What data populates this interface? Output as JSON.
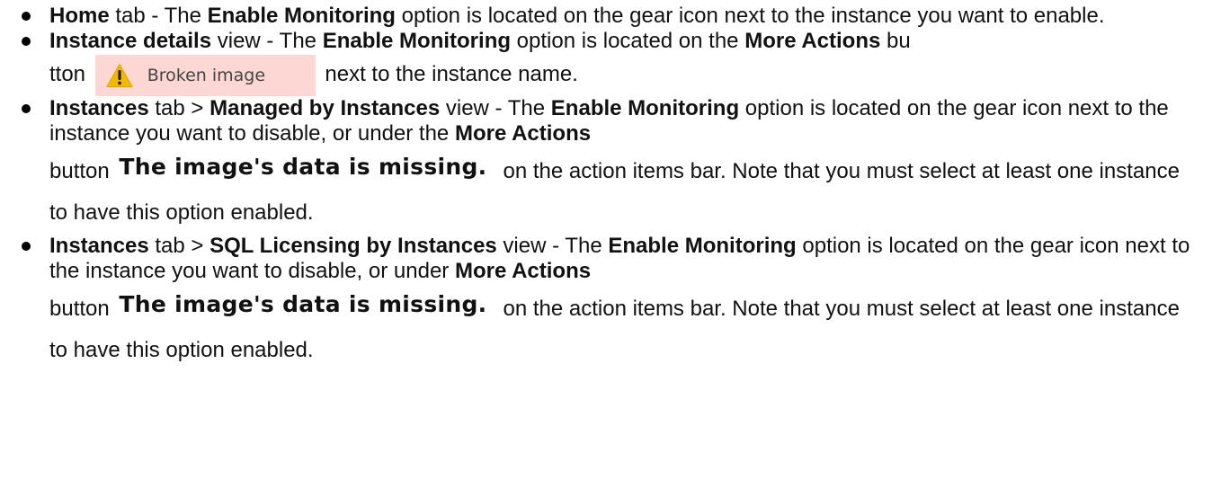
{
  "items": [
    {
      "segments": [
        "Home",
        " tab - The ",
        "Enable Monitoring",
        " option is located on the gear icon next to the instance you want to enable."
      ]
    },
    {
      "seg1": "Instance details",
      "seg2": " view - The ",
      "seg3": "Enable Monitoring",
      "seg4": " option is located on the  ",
      "seg5": "More Actions",
      "seg6": " bu",
      "seg7": "tton",
      "image_label": "Broken image",
      "seg8": "next to the instance name."
    },
    {
      "seg1": "Instances",
      "seg2": " tab >  ",
      "seg3": "Managed by Instances",
      "seg4": " view - The ",
      "seg5": "Enable Monitoring",
      "seg6": " option is located on the gear icon next to the instance you want to disable, or under the ",
      "seg7": "More Actions",
      "seg8": "button",
      "image_label": "The image's data is missing.",
      "seg9": "on the action items bar. Note that you must select at least one instance to have this option enabled."
    },
    {
      "seg1": "Instances",
      "seg2": " tab > ",
      "seg3": "SQL Licensing by Instances",
      "seg4": "  view - The ",
      "seg5": "Enable Monitoring",
      "seg6": " option is located on the gear icon next to the instance you want to disable, or under ",
      "seg7": "More Actions",
      "seg8": "button",
      "image_label": "The image's data is missing.",
      "seg9": "on the action items bar. Note that you must select at least one instance to have this option enabled."
    }
  ],
  "icons": {
    "warning": "warning-icon"
  },
  "colors": {
    "broken_image_bg": "#fcd7d3",
    "warning_yellow": "#f5b800"
  }
}
